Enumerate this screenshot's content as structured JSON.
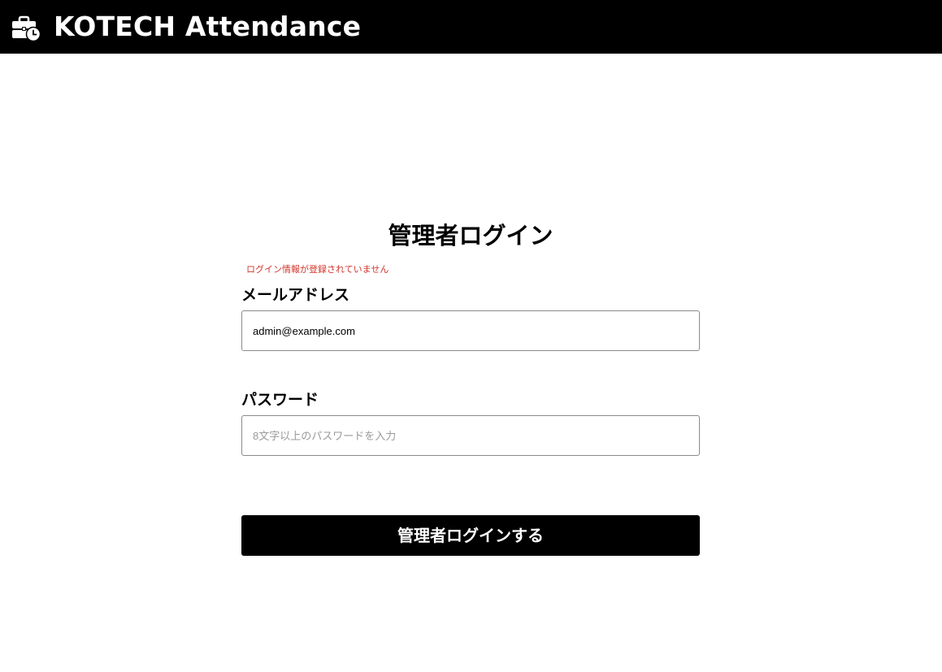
{
  "header": {
    "logo_icon": "briefcase-clock-icon",
    "title": "KOTECH Attendance"
  },
  "login_form": {
    "title": "管理者ログイン",
    "error_message": "ログイン情報が登録されていません",
    "email": {
      "label": "メールアドレス",
      "value": "admin@example.com",
      "placeholder": ""
    },
    "password": {
      "label": "パスワード",
      "value": "",
      "placeholder": "8文字以上のパスワードを入力"
    },
    "submit_label": "管理者ログインする"
  },
  "colors": {
    "header_background": "#000000",
    "button_background": "#000000",
    "error_text": "#d0352b"
  }
}
